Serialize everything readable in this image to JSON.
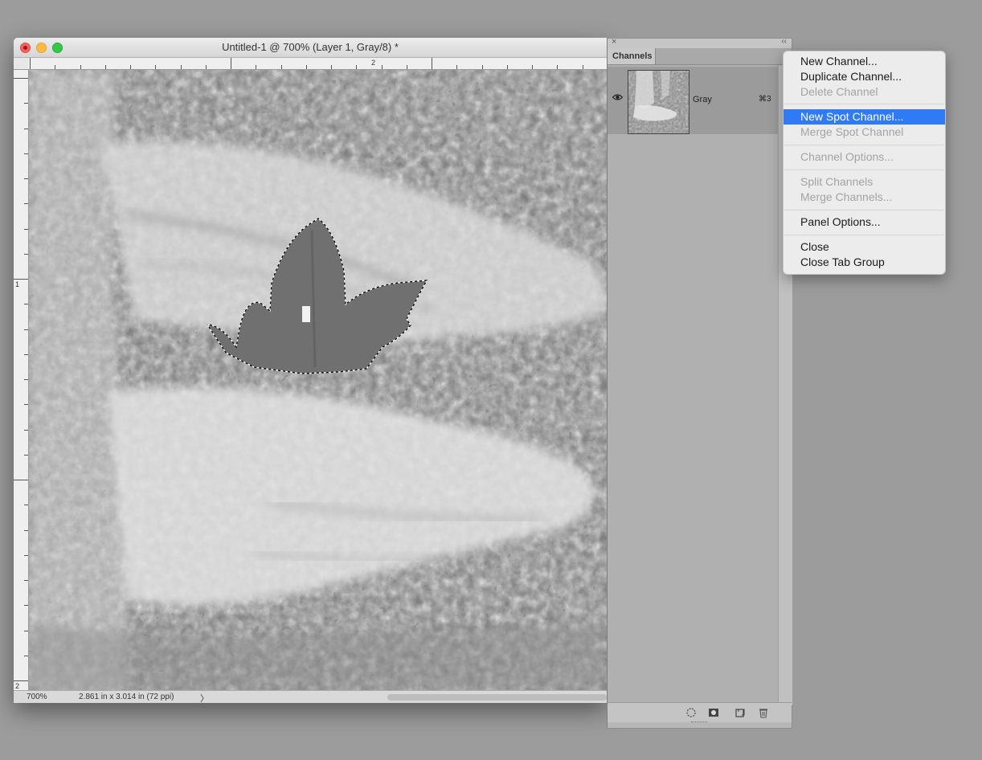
{
  "document": {
    "title": "Untitled-1 @ 700% (Layer 1, Gray/8) *",
    "ruler_top_label": "2",
    "ruler_left_labels": [
      "1",
      "2"
    ],
    "zoom": "700%",
    "doc_info": "2.861 in x 3.014 in (72 ppi)",
    "status_arrow": "〉"
  },
  "panel": {
    "close_glyph": "×",
    "collapse_glyph": "‹‹",
    "tab_label": "Channels",
    "menu_glyph": "≡",
    "channels": [
      {
        "name": "Gray",
        "shortcut": "⌘3",
        "visible": true
      }
    ],
    "bottom_icons": [
      "load-selection-icon",
      "save-selection-icon",
      "new-channel-icon",
      "delete-channel-icon"
    ]
  },
  "menu": {
    "items": [
      {
        "label": "New Channel...",
        "enabled": true,
        "selected": false
      },
      {
        "label": "Duplicate Channel...",
        "enabled": true,
        "selected": false
      },
      {
        "label": "Delete Channel",
        "enabled": false,
        "selected": false
      },
      {
        "label": "New Spot Channel...",
        "enabled": true,
        "selected": true
      },
      {
        "label": "Merge Spot Channel",
        "enabled": false,
        "selected": false
      },
      {
        "label": "Channel Options...",
        "enabled": false,
        "selected": false
      },
      {
        "label": "Split Channels",
        "enabled": false,
        "selected": false
      },
      {
        "label": "Merge Channels...",
        "enabled": false,
        "selected": false
      },
      {
        "label": "Panel Options...",
        "enabled": true,
        "selected": false
      },
      {
        "label": "Close",
        "enabled": true,
        "selected": false
      },
      {
        "label": "Close Tab Group",
        "enabled": true,
        "selected": false
      }
    ]
  },
  "colors": {
    "menu_highlight": "#2f7bf5",
    "close_light": "#fc605c",
    "minimize_light": "#fdbc40",
    "zoom_light": "#34c84a"
  }
}
